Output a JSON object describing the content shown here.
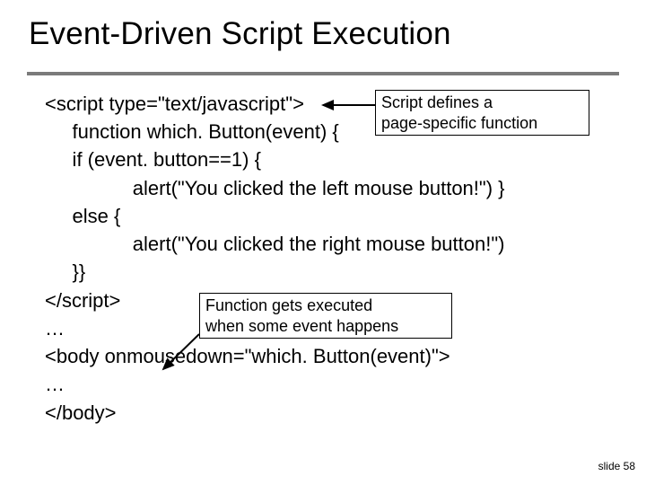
{
  "title": "Event-Driven Script Execution",
  "code": {
    "l1": "<script type=\"text/javascript\">",
    "l2": "     function which. Button(event) {",
    "l3": "     if (event. button==1) {",
    "l4": "                alert(\"You clicked the left mouse button!\") }",
    "l5": "     else {",
    "l6": "                alert(\"You clicked the right mouse button!\")",
    "l7": "     }}",
    "l8": "</script>",
    "l9": "…",
    "l10": "<body onmousedown=\"which. Button(event)\">",
    "l11": "…",
    "l12": "</body>"
  },
  "callouts": {
    "top_l1": "Script defines a",
    "top_l2": "page-specific function",
    "mid_l1": "Function gets executed",
    "mid_l2": "when some event happens"
  },
  "pagenum": "slide 58"
}
